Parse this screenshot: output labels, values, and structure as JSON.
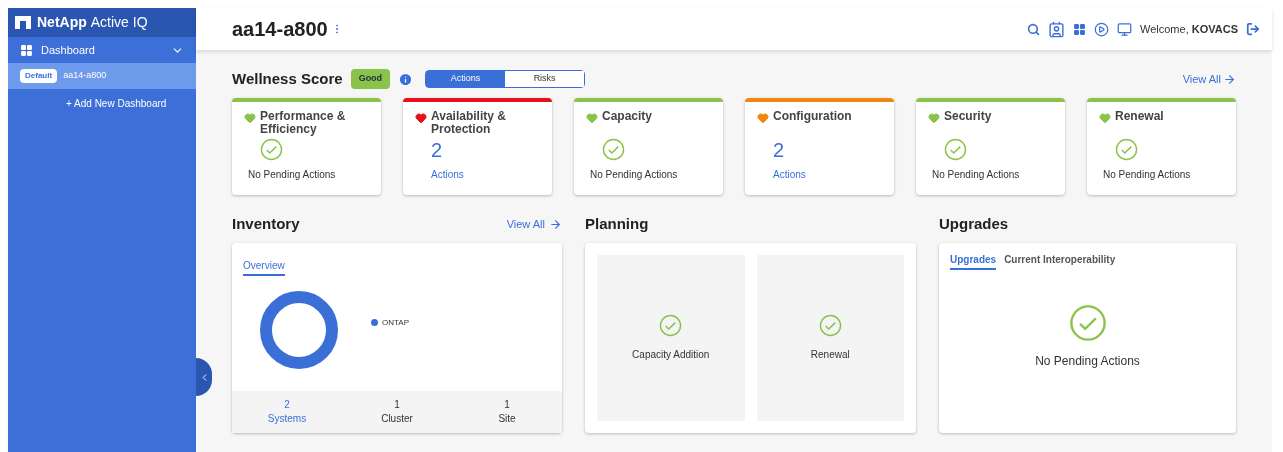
{
  "brand": {
    "name": "NetApp",
    "product": "Active IQ"
  },
  "sidebar": {
    "section": {
      "label": "Dashboard",
      "expanded": true
    },
    "items": [
      {
        "badge": "Default",
        "label": "aa14-a800",
        "selected": true
      }
    ],
    "add_link": "+ Add New Dashboard"
  },
  "header": {
    "title": "aa14-a800",
    "welcome": "Welcome,",
    "user": "KOVACS"
  },
  "wellness": {
    "title": "Wellness Score",
    "status": "Good",
    "tabs": [
      {
        "label": "Actions",
        "selected": true
      },
      {
        "label": "Risks",
        "selected": false
      }
    ],
    "view_all": "View All"
  },
  "cards": [
    {
      "title": "Performance & Efficiency",
      "color": "#8bc34a",
      "kind": "ok",
      "text": "No Pending Actions"
    },
    {
      "title": "Availability & Protection",
      "color": "#e8101a",
      "kind": "actions",
      "count": "2",
      "text": "Actions"
    },
    {
      "title": "Capacity",
      "color": "#8bc34a",
      "kind": "ok",
      "text": "No Pending Actions"
    },
    {
      "title": "Configuration",
      "color": "#f0860e",
      "kind": "actions",
      "count": "2",
      "text": "Actions"
    },
    {
      "title": "Security",
      "color": "#8bc34a",
      "kind": "ok",
      "text": "No Pending Actions"
    },
    {
      "title": "Renewal",
      "color": "#8bc34a",
      "kind": "ok",
      "text": "No Pending Actions"
    }
  ],
  "inventory": {
    "title": "Inventory",
    "view_all": "View All",
    "tabs": [
      {
        "label": "Overview",
        "selected": true
      }
    ],
    "legend": [
      "ONTAP"
    ],
    "stats": [
      {
        "value": "2",
        "label": "Systems",
        "link": true
      },
      {
        "value": "1",
        "label": "Cluster",
        "link": false
      },
      {
        "value": "1",
        "label": "Site",
        "link": false
      }
    ]
  },
  "planning": {
    "title": "Planning",
    "tiles": [
      "Capacity Addition",
      "Renewal"
    ]
  },
  "upgrades": {
    "title": "Upgrades",
    "tabs": [
      {
        "label": "Upgrades",
        "selected": true
      },
      {
        "label": "Current Interoperability",
        "selected": false
      }
    ],
    "text": "No Pending Actions"
  }
}
